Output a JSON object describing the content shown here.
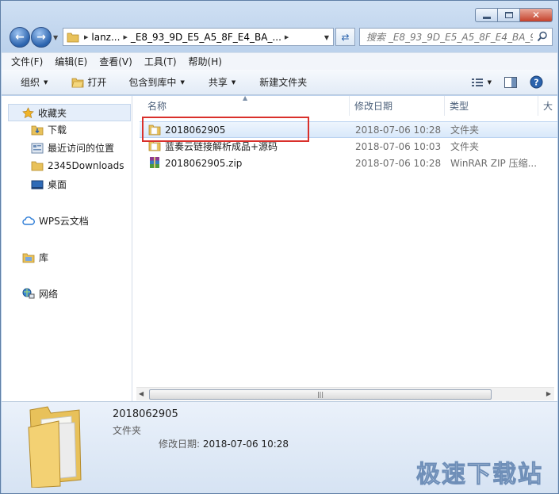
{
  "caption": {
    "minimize": "",
    "maximize": "",
    "close": "✕"
  },
  "address": {
    "crumbs": [
      "lanz...",
      "_E8_93_9D_E5_A5_8F_E4_BA_..."
    ],
    "search_placeholder": "搜索 _E8_93_9D_E5_A5_8F_E4_BA_9..."
  },
  "menu": [
    "文件(F)",
    "编辑(E)",
    "查看(V)",
    "工具(T)",
    "帮助(H)"
  ],
  "toolbar": {
    "organize": "组织",
    "open": "打开",
    "include_library": "包含到库中",
    "share": "共享",
    "new_folder": "新建文件夹"
  },
  "nav_pane": {
    "favorites": "收藏夹",
    "downloads": "下载",
    "recent": "最近访问的位置",
    "downloads2345": "2345Downloads",
    "desktop": "桌面",
    "wps": "WPS云文档",
    "libraries": "库",
    "network": "网络"
  },
  "columns": {
    "name": "名称",
    "date": "修改日期",
    "type": "类型",
    "size": "大"
  },
  "files": [
    {
      "name": "2018062905",
      "date": "2018-07-06 10:28",
      "type": "文件夹",
      "kind": "folder"
    },
    {
      "name": "蓝奏云链接解析成品+源码",
      "date": "2018-07-06 10:03",
      "type": "文件夹",
      "kind": "folder"
    },
    {
      "name": "2018062905.zip",
      "date": "2018-07-06 10:28",
      "type": "WinRAR ZIP 压缩...",
      "kind": "zip"
    }
  ],
  "details": {
    "name": "2018062905",
    "type": "文件夹",
    "date_label": "修改日期:",
    "date_value": "2018-07-06 10:28"
  },
  "watermark": "极速下载站",
  "colors": {
    "highlight_border": "#d9302b",
    "folder": "#e8c15a"
  }
}
